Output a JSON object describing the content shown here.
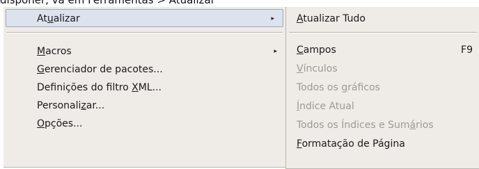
{
  "top_text": "disponer, vá em Ferramentas > Atualizar",
  "left_menu": {
    "items": [
      {
        "pre": "At",
        "acc": "u",
        "post": "alizar",
        "has_submenu": true,
        "selected": true
      },
      {
        "pre": "",
        "acc": "M",
        "post": "acros",
        "has_submenu": true
      },
      {
        "pre": "",
        "acc": "G",
        "post": "erenciador de pacotes...",
        "has_submenu": false
      },
      {
        "pre": "Definições do filtro ",
        "acc": "X",
        "post": "ML...",
        "has_submenu": false
      },
      {
        "pre": "Personali",
        "acc": "z",
        "post": "ar...",
        "has_submenu": false
      },
      {
        "pre": "",
        "acc": "O",
        "post": "pções...",
        "has_submenu": false
      }
    ],
    "submenu_arrow": "▸"
  },
  "right_menu": {
    "items": [
      {
        "pre": "",
        "acc": "A",
        "post": "tualizar Tudo",
        "enabled": true
      },
      {
        "pre": "",
        "acc": "C",
        "post": "ampos",
        "shortcut": "F9",
        "enabled": true
      },
      {
        "pre": "",
        "acc": "V",
        "post": "ínculos",
        "enabled": false
      },
      {
        "pre": "Todos os ",
        "acc": "g",
        "post": "ráficos",
        "enabled": false
      },
      {
        "pre": "",
        "acc": "Í",
        "post": "ndice Atual",
        "enabled": false
      },
      {
        "pre": "Todos os Índices e Sum",
        "acc": "á",
        "post": "rios",
        "enabled": false
      },
      {
        "pre": "",
        "acc": "F",
        "post": "ormatação de Página",
        "enabled": true
      }
    ]
  }
}
